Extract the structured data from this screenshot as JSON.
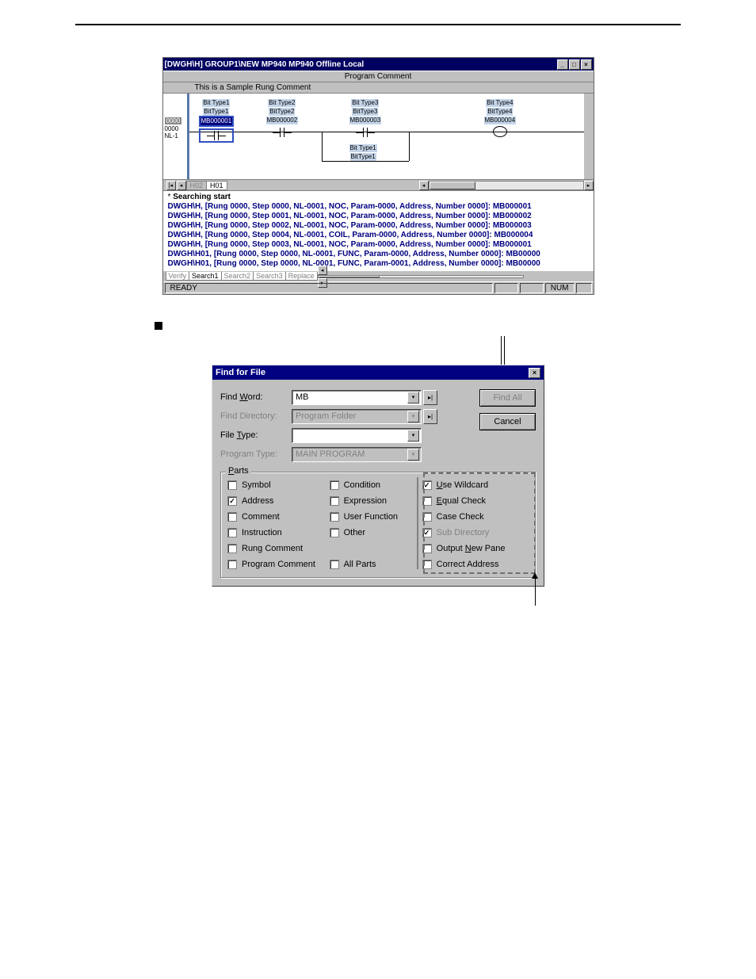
{
  "window": {
    "title": "[DWGH\\H]    GROUP1\\NEW  MP940  MP940       Offline  Local",
    "programComment": "Program Comment",
    "sampleComment": "This is a Sample Rung Comment",
    "rungInfo": {
      "badge": "0000",
      "line2": "0000",
      "line3": "NL-1"
    },
    "elements": {
      "e1": {
        "type": "Bit Type1",
        "name": "BitType1",
        "addr": "MB000001"
      },
      "e2": {
        "type": "Bit Type2",
        "name": "BitType2",
        "addr": "MB000002"
      },
      "e3": {
        "type": "Bit Type3",
        "name": "BitType3",
        "addr": "MB000003"
      },
      "e4": {
        "type": "Bit Type4",
        "name": "BitType4",
        "addr": "MB000004"
      },
      "e5": {
        "type": "Bit Type1",
        "name": "BitType1"
      }
    },
    "tabs": {
      "h02": "H02",
      "h01": "H01"
    }
  },
  "output": {
    "header": "Searching start",
    "star": "*",
    "lines": [
      "DWGH\\H, [Rung 0000, Step 0000, NL-0001, NOC, Param-0000, Address, Number 0000]: MB000001",
      "DWGH\\H, [Rung 0000, Step 0001, NL-0001, NOC, Param-0000, Address, Number 0000]: MB000002",
      "DWGH\\H, [Rung 0000, Step 0002, NL-0001, NOC, Param-0000, Address, Number 0000]: MB000003",
      "DWGH\\H, [Rung 0000, Step 0004, NL-0001, COIL, Param-0000, Address, Number 0000]: MB000004",
      "DWGH\\H, [Rung 0000, Step 0003, NL-0001, NOC, Param-0000, Address, Number 0000]: MB000001",
      "DWGH\\H01, [Rung 0000, Step 0000, NL-0001, FUNC, Param-0000, Address, Number 0000]: MB00000",
      "DWGH\\H01, [Rung 0000, Step 0000, NL-0001, FUNC, Param-0001, Address, Number 0000]: MB00000"
    ],
    "tabs": {
      "verify": "Verify",
      "search1": "Search1",
      "search2": "Search2",
      "search3": "Search3",
      "replace": "Replace"
    }
  },
  "statusbar": {
    "ready": "READY",
    "num": "NUM"
  },
  "dialog": {
    "title": "Find for File",
    "findWord": {
      "label": "Find Word:",
      "value": "MB"
    },
    "findDirectory": {
      "label": "Find Directory:",
      "value": "Program Folder"
    },
    "fileType": {
      "label": "File Type:",
      "value": ""
    },
    "programType": {
      "label": "Program Type:",
      "value": "MAIN PROGRAM"
    },
    "buttons": {
      "findAll": "Find All",
      "cancel": "Cancel"
    },
    "partsLabel": "Parts",
    "col1": {
      "symbol": "Symbol",
      "address": "Address",
      "comment": "Comment",
      "instruction": "Instruction",
      "rungComment": "Rung Comment",
      "programComment": "Program Comment"
    },
    "col2": {
      "condition": "Condition",
      "expression": "Expression",
      "userFunction": "User Function",
      "other": "Other",
      "allParts": "All Parts"
    },
    "col3": {
      "useWildcard": "Use Wildcard",
      "equalCheck": "Equal Check",
      "caseCheck": "Case Check",
      "subDirectory": "Sub Directory",
      "outputNewPane": "Output New Pane",
      "correctAddress": "Correct Address"
    }
  }
}
